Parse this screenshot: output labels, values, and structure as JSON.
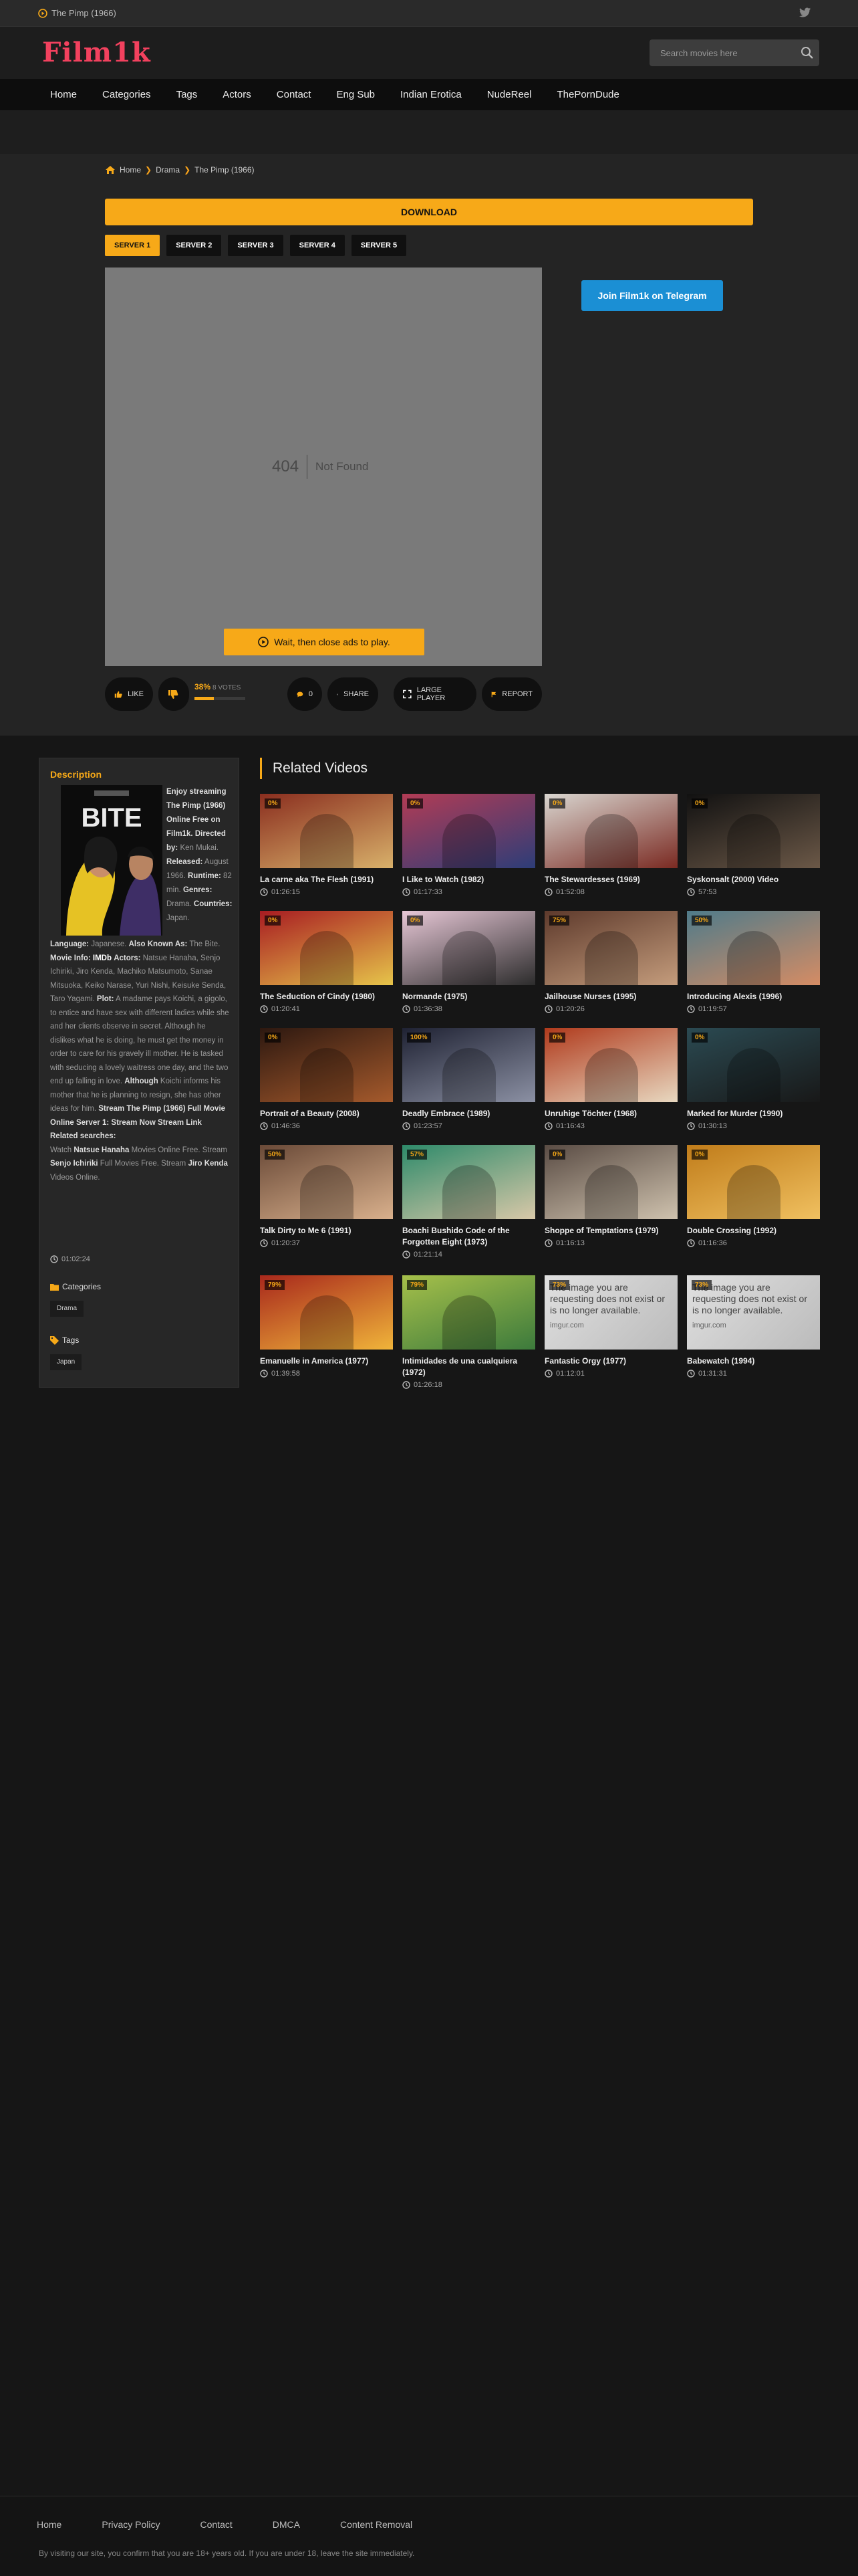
{
  "topbar": {
    "now_playing": "The Pimp (1966)"
  },
  "header": {
    "logo": "Film1k",
    "search_placeholder": "Search movies here"
  },
  "nav": [
    "Home",
    "Categories",
    "Tags",
    "Actors",
    "Contact",
    "Eng Sub",
    "Indian Erotica",
    "NudeReel",
    "ThePornDude"
  ],
  "breadcrumb": {
    "home": "Home",
    "category": "Drama",
    "current": "The Pimp (1966)"
  },
  "download_label": "DOWNLOAD",
  "servers": [
    "SERVER 1",
    "SERVER 2",
    "SERVER 3",
    "SERVER 4",
    "SERVER 5"
  ],
  "player": {
    "code": "404",
    "message": "Not Found",
    "wait_label": "Wait, then close ads to play."
  },
  "telegram_label": "Join Film1k on Telegram",
  "actions": {
    "like": "LIKE",
    "rating_pct": "38%",
    "votes": "8 VOTES",
    "rating_value": 0.38,
    "comments": "0",
    "share": "SHARE",
    "large_player": "LARGE PLAYER",
    "report": "REPORT"
  },
  "description": {
    "heading": "Description",
    "poster_text": "BITE",
    "w1": "Enjoy streaming The Pimp (1966) Online Free on Film1k. Directed by:",
    "w2": "Ken Mukai.",
    "w3": "Released:",
    "w4": "August 1966.",
    "w5": "Runtime:",
    "w6": "82 min.",
    "w7": "Genres:",
    "w8": "Drama.",
    "w9": "Countries:",
    "w10": "Japan.",
    "f1": "Language:",
    "f2": "Japanese.",
    "f3": "Also Known As:",
    "f4": "The Bite.",
    "f5": "Movie Info:",
    "f6": "IMDb",
    "f7": "Actors:",
    "f8": "Natsue Hanaha, Senjo Ichiriki, Jiro Kenda, Machiko Matsumoto, Sanae Mitsuoka, Keiko Narase, Yuri Nishi, Keisuke Senda, Taro Yagami.",
    "f9": "Plot:",
    "f10": "A madame pays Koichi, a gigolo, to entice and have sex with different ladies while she and her clients observe in secret. Although he dislikes what he is doing, he must get the money in order to care for his gravely ill mother. He is tasked with seducing a lovely waitress one day, and the two end up falling in love.",
    "f11": "Although",
    "f12": "Koichi informs his mother that he is planning to resign, she has other ideas for him.",
    "f13": "Stream The Pimp (1966) Full Movie Online Server 1: Stream Now Stream Link",
    "related_title": "Related searches:",
    "r1": "Watch",
    "r2": "Natsue Hanaha",
    "r3": "Movies Online Free. Stream",
    "r4": "Senjo Ichiriki",
    "r5": "Full Movies Free. Stream",
    "r6": "Jiro Kenda",
    "r7": "Videos Online.",
    "duration": "01:02:24",
    "categories_label": "Categories",
    "category_tag": "Drama",
    "tags_label": "Tags",
    "tag": "Japan"
  },
  "related": {
    "heading": "Related Videos",
    "items": [
      {
        "title": "La carne aka The Flesh (1991)",
        "dur": "01:26:15",
        "badge": "0%",
        "c1": "#8a2e1f",
        "c2": "#d8b06a"
      },
      {
        "title": "I Like to Watch (1982)",
        "dur": "01:17:33",
        "badge": "0%",
        "c1": "#b23c55",
        "c2": "#2d3d78"
      },
      {
        "title": "The Stewardesses (1969)",
        "dur": "01:52:08",
        "badge": "0%",
        "c1": "#d9d6d0",
        "c2": "#7a2a22"
      },
      {
        "title": "Syskonsalt (2000) Video",
        "dur": "57:53",
        "badge": "0%",
        "c1": "#111111",
        "c2": "#6b5847"
      },
      {
        "title": "The Seduction of Cindy (1980)",
        "dur": "01:20:41",
        "badge": "0%",
        "c1": "#a81c22",
        "c2": "#e6c44a"
      },
      {
        "title": "Normande (1975)",
        "dur": "01:36:38",
        "badge": "0%",
        "c1": "#e7c7d6",
        "c2": "#2c2c2c"
      },
      {
        "title": "Jailhouse Nurses (1995)",
        "dur": "01:20:26",
        "badge": "75%",
        "c1": "#5e3a2c",
        "c2": "#c49c7c"
      },
      {
        "title": "Introducing Alexis (1996)",
        "dur": "01:19:57",
        "badge": "50%",
        "c1": "#4f7b8a",
        "c2": "#d58c64"
      },
      {
        "title": "Portrait of a Beauty (2008)",
        "dur": "01:46:36",
        "badge": "0%",
        "c1": "#2d1810",
        "c2": "#a55a2c"
      },
      {
        "title": "Deadly Embrace (1989)",
        "dur": "01:23:57",
        "badge": "100%",
        "c1": "#1f2233",
        "c2": "#8b90a3"
      },
      {
        "title": "Unruhige Töchter (1968)",
        "dur": "01:16:43",
        "badge": "0%",
        "c1": "#b03a1c",
        "c2": "#e8d8c0"
      },
      {
        "title": "Marked for Murder (1990)",
        "dur": "01:30:13",
        "badge": "0%",
        "c1": "#2b4a52",
        "c2": "#181818"
      },
      {
        "title": "Talk Dirty to Me 6 (1991)",
        "dur": "01:20:37",
        "badge": "50%",
        "c1": "#6a4a38",
        "c2": "#d9b08c"
      },
      {
        "title": "Boachi Bushido Code of the Forgotten Eight (1973)",
        "dur": "01:21:14",
        "badge": "57%",
        "c1": "#2e8a6a",
        "c2": "#d8c8a8"
      },
      {
        "title": "Shoppe of Temptations (1979)",
        "dur": "01:16:13",
        "badge": "0%",
        "c1": "#5a4c44",
        "c2": "#cfc2ae"
      },
      {
        "title": "Double Crossing (1992)",
        "dur": "01:16:36",
        "badge": "0%",
        "c1": "#c07c1a",
        "c2": "#f0c060"
      },
      {
        "title": "Emanuelle in America (1977)",
        "dur": "01:39:58",
        "badge": "79%",
        "c1": "#a8281c",
        "c2": "#f0b43a"
      },
      {
        "title": "Intimidades de una cualquiera (1972)",
        "dur": "01:26:18",
        "badge": "79%",
        "c1": "#a6c04a",
        "c2": "#3c7a3c"
      },
      {
        "title": "Fantastic Orgy (1977)",
        "dur": "01:12:01",
        "badge": "73%",
        "c1": "#e0e0e0",
        "c2": "#bbbbbb",
        "missing": "The image you are requesting does not exist or is no longer available.",
        "host": "imgur.com"
      },
      {
        "title": "Babewatch (1994)",
        "dur": "01:31:31",
        "badge": "73%",
        "c1": "#e0e0e0",
        "c2": "#bbbbbb",
        "missing": "The image you are requesting does not exist or is no longer available.",
        "host": "imgur.com"
      }
    ]
  },
  "footer": {
    "links": [
      "Home",
      "Privacy Policy",
      "Contact",
      "DMCA",
      "Content Removal"
    ],
    "copy": "By visiting our site, you confirm that you are 18+ years old. If you are under 18, leave the site immediately."
  },
  "colors": {
    "accent": "#f7a918",
    "logo": "#f2415e",
    "telegram": "#1b8fd4"
  }
}
